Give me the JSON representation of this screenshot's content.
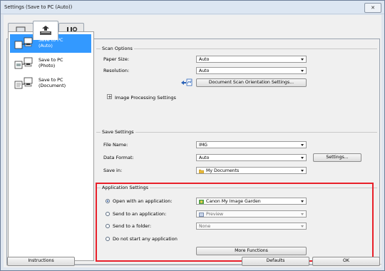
{
  "window": {
    "title": "Settings (Save to PC (Auto))",
    "close_glyph": "✕"
  },
  "tabs": [
    {
      "icon": "scan-from-computer-icon"
    },
    {
      "icon": "scan-from-operation-panel-icon",
      "selected": true
    },
    {
      "icon": "general-settings-icon"
    }
  ],
  "sidebar": {
    "items": [
      {
        "line1": "Save to PC",
        "line2": "(Auto)",
        "selected": true
      },
      {
        "line1": "Save to PC",
        "line2": "(Photo)"
      },
      {
        "line1": "Save to PC",
        "line2": "(Document)"
      }
    ]
  },
  "scan_options": {
    "title": "Scan Options",
    "paper_size_label": "Paper Size:",
    "paper_size_value": "Auto",
    "resolution_label": "Resolution:",
    "resolution_value": "Auto",
    "orientation_button": "Document Scan Orientation Settings...",
    "image_processing_label": "Image Processing Settings",
    "expand_glyph": "+"
  },
  "save_settings": {
    "title": "Save Settings",
    "file_name_label": "File Name:",
    "file_name_value": "IMG",
    "data_format_label": "Data Format:",
    "data_format_value": "Auto",
    "settings_button": "Settings...",
    "save_in_label": "Save in:",
    "save_in_value": "My Documents"
  },
  "application_settings": {
    "title": "Application Settings",
    "open_with_label": "Open with an application:",
    "open_with_value": "Canon My Image Garden",
    "send_to_app_label": "Send to an application:",
    "send_to_app_value": "Preview",
    "send_to_folder_label": "Send to a folder:",
    "send_to_folder_value": "None",
    "do_not_start_label": "Do not start any application",
    "more_functions_button": "More Functions",
    "selected_option": "open_with"
  },
  "footer": {
    "instructions_button": "Instructions",
    "defaults_button": "Defaults",
    "ok_button": "OK"
  },
  "colors": {
    "selection_blue": "#3399ff",
    "highlight_red": "#e8202a",
    "window_frame": "#6e7f99"
  }
}
